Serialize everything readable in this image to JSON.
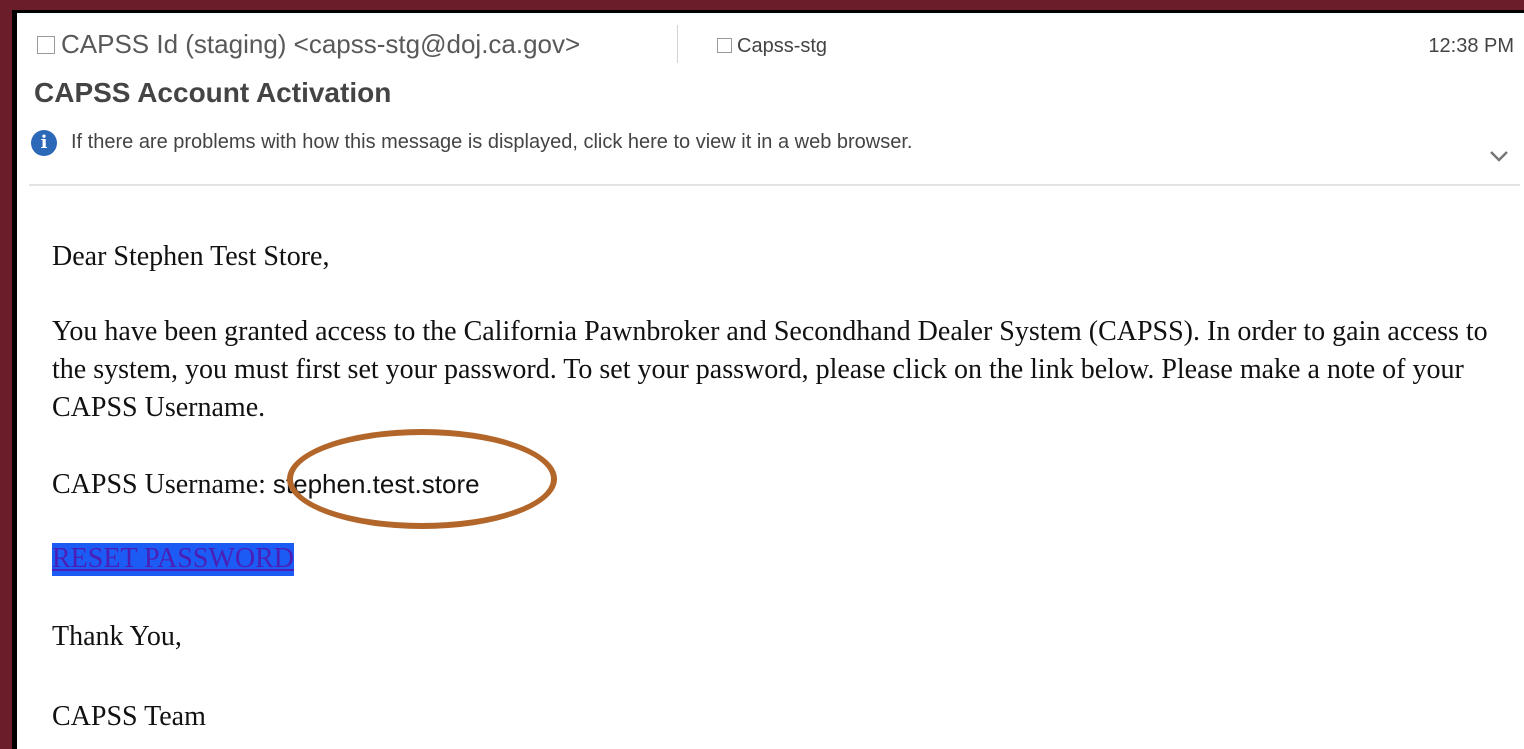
{
  "header": {
    "from": "CAPSS Id (staging) <capss-stg@doj.ca.gov>",
    "to": "Capss-stg",
    "time": "12:38 PM",
    "subject": "CAPSS Account Activation",
    "info_message": "If there are problems with how this message is displayed, click here to view it in a web browser."
  },
  "body": {
    "greeting": "Dear Stephen Test Store,",
    "paragraph": "You have been granted access to the California Pawnbroker and Secondhand Dealer System (CAPSS). In order to gain access to the system, you must first set your password. To set your password, please click on the link below. Please make a note of your CAPSS Username.",
    "username_label": "CAPSS Username: ",
    "username_value": "stephen.test.store",
    "reset_link": "RESET PASSWORD",
    "closing": "Thank You,",
    "signature": "CAPSS Team"
  },
  "colors": {
    "frame": "#6b1e2a",
    "annotation_oval": "#b3662a",
    "link_highlight": "#1c5cf5",
    "info_icon": "#2c68b8"
  }
}
